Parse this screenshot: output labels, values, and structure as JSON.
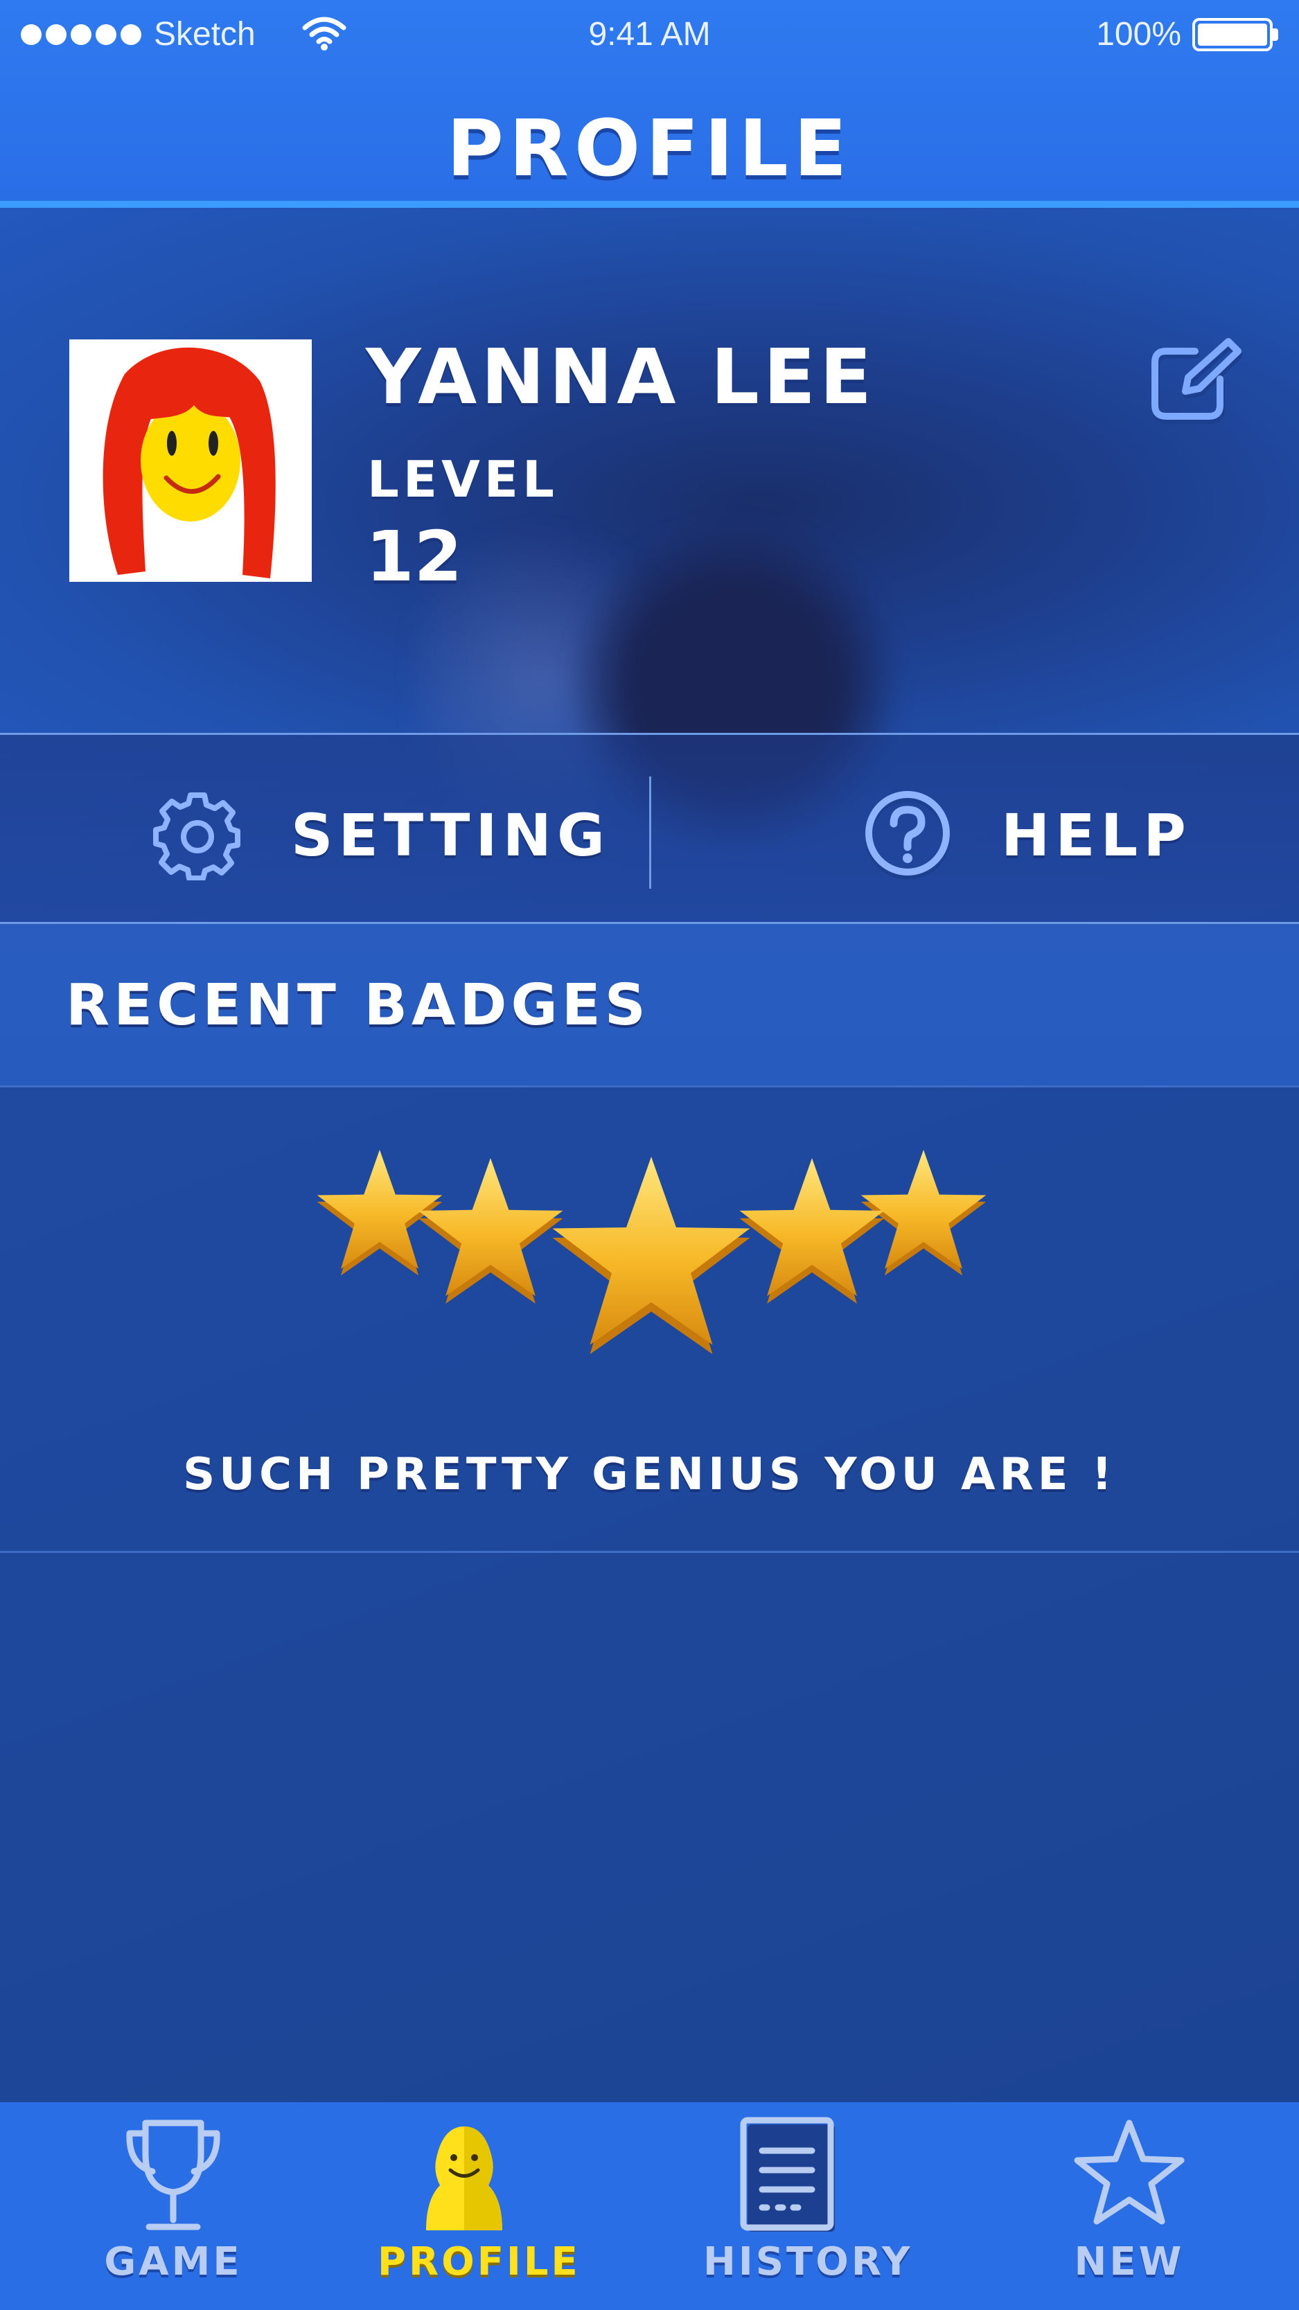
{
  "status_bar": {
    "carrier": "Sketch",
    "time": "9:41 AM",
    "battery": "100%",
    "signal_icon": "signal-dots-icon",
    "wifi_icon": "wifi-icon",
    "battery_icon": "battery-icon"
  },
  "header": {
    "title": "PROFILE"
  },
  "profile": {
    "name": "YANNA LEE",
    "level_label": "LEVEL",
    "level_value": "12",
    "edit_icon": "edit-icon"
  },
  "actions": {
    "setting_label": "SETTING",
    "setting_icon": "gear-icon",
    "help_label": "HELP",
    "help_icon": "question-circle-icon"
  },
  "badges": {
    "section_label": "RECENT BADGES",
    "star_count": 5,
    "message": "SUCH PRETTY GENIUS YOU ARE !"
  },
  "tabbar": {
    "active": "profile",
    "tabs": [
      {
        "id": "game",
        "label": "GAME",
        "icon": "trophy-icon"
      },
      {
        "id": "profile",
        "label": "PROFILE",
        "icon": "smiley-person-icon"
      },
      {
        "id": "history",
        "label": "HISTORY",
        "icon": "document-list-icon"
      },
      {
        "id": "new",
        "label": "NEW",
        "icon": "star-outline-icon"
      }
    ]
  },
  "colors": {
    "header_blue": "#2a6ee6",
    "accent_yellow": "#ffe01a",
    "inactive_tab": "#b9cdf2",
    "star_gold": "#f7b928"
  }
}
